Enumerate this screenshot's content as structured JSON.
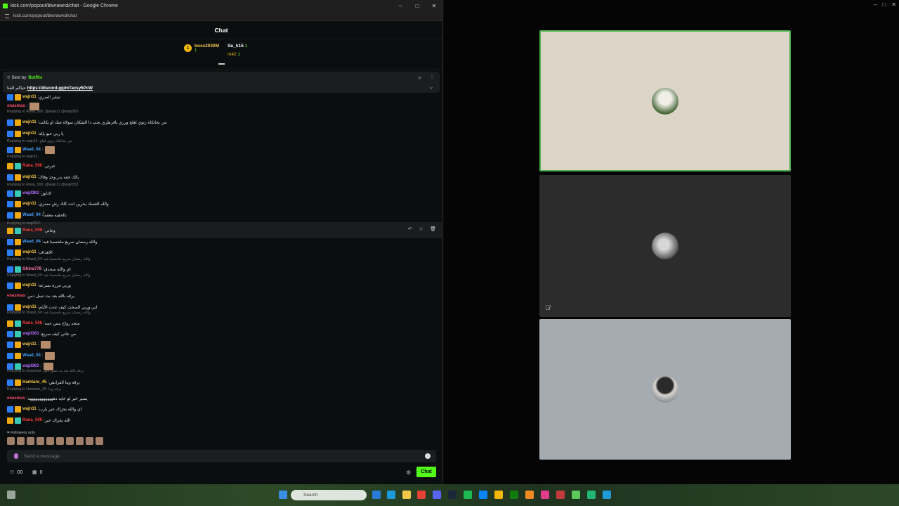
{
  "window": {
    "title": "kick.com/popout/blwrawnd/chat - Google Chrome",
    "url": "kick.com/popout/blwrawnd/chat"
  },
  "chat": {
    "title": "Chat",
    "leaderboard": [
      {
        "rank": "1",
        "name": "boss2030M",
        "count": "1"
      },
      {
        "name": "Su_k15",
        "count": "1"
      },
      {
        "name": "m42",
        "count": "1"
      }
    ],
    "pinned": {
      "sent_by_label": "Sent by",
      "bot_name": "BotRix",
      "prefix": "حياكم القنا",
      "link": "https://discord.gg/mTacsy5PcW"
    },
    "messages": [
      {
        "user": "wajn11",
        "color": "#f6c944",
        "text": "تبشر الضري",
        "badges": [
          "blue",
          "gold"
        ]
      },
      {
        "user": "enasmas",
        "color": "#ff4d6d",
        "text": "",
        "badges": []
      },
      {
        "user": "wajn11",
        "color": "#f6c944",
        "text": "من بحاثكاه رتوي لعلح ورري يافرطري بحب ذا الشكان سولاه شك او بكانت",
        "badges": [
          "blue",
          "gold"
        ]
      },
      {
        "user": "wajn11",
        "color": "#f6c944",
        "text": "يا ربي حيو بإله",
        "badges": [
          "blue",
          "gold"
        ]
      },
      {
        "user": "Waad_04",
        "color": "#4aa3ff",
        "text": "",
        "badges": [
          "blue",
          "gold"
        ]
      },
      {
        "user": "Rana_506",
        "color": "#ff3b3b",
        "text": "عبرتي",
        "badges": [
          "gold",
          "teal"
        ]
      },
      {
        "user": "wajn11",
        "color": "#f6c944",
        "text": "بالك حقه بدر وحد وقاك",
        "badges": [
          "blue",
          "gold"
        ]
      },
      {
        "user": "wajd363",
        "color": "#b76cff",
        "text": "لاذلوز",
        "badges": [
          "blue",
          "teal"
        ]
      },
      {
        "user": "wajn11",
        "color": "#f6c944",
        "text": "والله العسك يحرين انت كلك رش مسري",
        "badges": [
          "blue",
          "gold"
        ]
      },
      {
        "user": "Waad_04",
        "color": "#4aa3ff",
        "text": "بالحقيه معقماً",
        "badges": [
          "blue",
          "gold"
        ]
      },
      {
        "user": "Rana_506",
        "color": "#ff3b3b",
        "text": "وحاني",
        "badges": [
          "gold",
          "teal"
        ]
      },
      {
        "user": "Waad_04",
        "color": "#4aa3ff",
        "text": "والله رمضان سريع ملحسينا فيه",
        "badges": [
          "blue",
          "gold"
        ]
      },
      {
        "user": "wajn11",
        "color": "#f6c944",
        "text": "الاهداف",
        "badges": [
          "blue",
          "gold"
        ]
      },
      {
        "user": "Ghina778",
        "color": "#ff7ab6",
        "text": "اي والله صحدق",
        "badges": [
          "blue",
          "teal"
        ]
      },
      {
        "user": "wajn11",
        "color": "#f6c944",
        "text": "وربي مرره بسرعه",
        "badges": [
          "blue",
          "gold"
        ]
      },
      {
        "user": "enasmas",
        "color": "#ff4d6d",
        "text": "يرقه بالله بعد بت تسل دس",
        "badges": []
      },
      {
        "user": "wajn11",
        "color": "#f6c944",
        "text": "ايي وربي الصحت كيف عدت الأيام",
        "badges": [
          "blue",
          "gold"
        ]
      },
      {
        "user": "Rana_506",
        "color": "#ff3b3b",
        "text": "متجد رواح ببس عمه",
        "badges": [
          "gold",
          "teal"
        ]
      },
      {
        "user": "wajd363",
        "color": "#b76cff",
        "text": "من جاني كيف سريع",
        "badges": [
          "blue",
          "teal"
        ]
      },
      {
        "user": "wajn11",
        "color": "#f6c944",
        "text": "",
        "badges": [
          "blue",
          "gold"
        ]
      },
      {
        "user": "Waad_04",
        "color": "#4aa3ff",
        "text": "",
        "badges": [
          "blue",
          "gold"
        ]
      },
      {
        "user": "wajd363",
        "color": "#b76cff",
        "text": "",
        "badges": [
          "blue",
          "teal"
        ]
      },
      {
        "user": "Hamtaro_45",
        "color": "#f6c944",
        "text": "يرقه وينا الفرانش",
        "badges": [
          "blue",
          "gold"
        ]
      },
      {
        "user": "enasmas",
        "color": "#ff4d6d",
        "text": "يسير خير لو خايه دهههههههههههههه",
        "badges": []
      },
      {
        "user": "wajn11",
        "color": "#f6c944",
        "text": "اي والله يجزاك خير يارب",
        "badges": [
          "blue",
          "gold"
        ]
      },
      {
        "user": "Rana_506",
        "color": "#ff3b3b",
        "text": "الله يجزاك خير",
        "badges": [
          "gold",
          "teal"
        ]
      }
    ],
    "replies": [
      {
        "text": "Replying to Rana_506: @wajn11 @wajd363"
      },
      {
        "text": "Replying to wajn11: من بحاثكاه رتوي لعلح"
      },
      {
        "text": "Replying to wajn11:"
      },
      {
        "text": "Replying to Rana_506: @wajn11 @wajd363"
      },
      {
        "text": "Replying to wajd363:"
      },
      {
        "text": "Replying to Waad_04: والله رمضان سريع ملحسينا فيه"
      },
      {
        "text": "Replying to Waad_04: والله رمضان سريع ملحسينا فيه"
      },
      {
        "text": "Replying to Waad_04: والله رمضان سريع ملحسينا فيه"
      },
      {
        "text": "Replying to enasmas: يرقه بالله بعد بت تسل دس"
      },
      {
        "text": "Replying to Hamtaro_45: يرقه وينا"
      }
    ],
    "followers_only": "Followers only",
    "composer_placeholder": "Send a message",
    "viewers": "00",
    "count": "0",
    "chat_button": "Chat"
  },
  "taskbar": {
    "search_placeholder": "Search"
  },
  "colors": {
    "kick_green": "#53fc18",
    "active_speaker_border": "#4caf50"
  }
}
